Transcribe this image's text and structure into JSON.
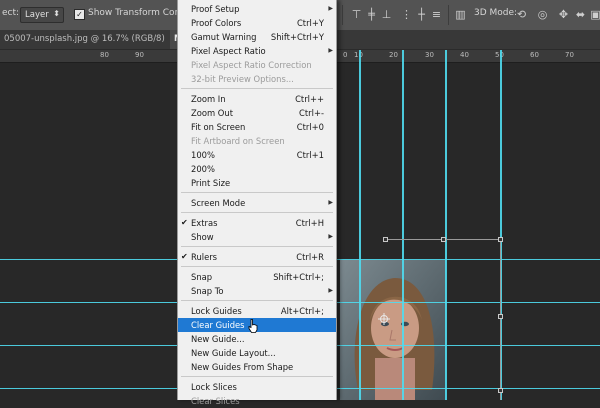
{
  "options_bar": {
    "prefix_label": "ect:",
    "select_value": "Layer",
    "checkbox_label": "Show Transform Controls",
    "mode_3d_label": "3D Mode:"
  },
  "tabs": [
    {
      "label": "05007-unsplash.jpg @ 16.7% (RGB/8)"
    },
    {
      "label": "My"
    }
  ],
  "ruler": {
    "labels": [
      "10",
      "20",
      "30",
      "40",
      "50",
      "60",
      "70",
      "80",
      "90",
      "0"
    ]
  },
  "colors": {
    "guide": "#4fdcf0",
    "highlight": "#1f79d3",
    "menu_bg": "#f0f0f0"
  },
  "view_menu": [
    {
      "type": "item",
      "label": "Proof Setup",
      "shortcut": "",
      "submenu": true
    },
    {
      "type": "item",
      "label": "Proof Colors",
      "shortcut": "Ctrl+Y"
    },
    {
      "type": "item",
      "label": "Gamut Warning",
      "shortcut": "Shift+Ctrl+Y"
    },
    {
      "type": "item",
      "label": "Pixel Aspect Ratio",
      "shortcut": "",
      "submenu": true
    },
    {
      "type": "item",
      "label": "Pixel Aspect Ratio Correction",
      "disabled": true
    },
    {
      "type": "item",
      "label": "32-bit Preview Options...",
      "disabled": true
    },
    {
      "type": "separator"
    },
    {
      "type": "item",
      "label": "Zoom In",
      "shortcut": "Ctrl++"
    },
    {
      "type": "item",
      "label": "Zoom Out",
      "shortcut": "Ctrl+-"
    },
    {
      "type": "item",
      "label": "Fit on Screen",
      "shortcut": "Ctrl+0"
    },
    {
      "type": "item",
      "label": "Fit Artboard on Screen",
      "disabled": true
    },
    {
      "type": "item",
      "label": "100%",
      "shortcut": "Ctrl+1"
    },
    {
      "type": "item",
      "label": "200%"
    },
    {
      "type": "item",
      "label": "Print Size"
    },
    {
      "type": "separator"
    },
    {
      "type": "item",
      "label": "Screen Mode",
      "submenu": true
    },
    {
      "type": "separator"
    },
    {
      "type": "item",
      "label": "Extras",
      "shortcut": "Ctrl+H",
      "checked": true
    },
    {
      "type": "item",
      "label": "Show",
      "submenu": true
    },
    {
      "type": "separator"
    },
    {
      "type": "item",
      "label": "Rulers",
      "shortcut": "Ctrl+R",
      "checked": true
    },
    {
      "type": "separator"
    },
    {
      "type": "item",
      "label": "Snap",
      "shortcut": "Shift+Ctrl+;"
    },
    {
      "type": "item",
      "label": "Snap To",
      "submenu": true
    },
    {
      "type": "separator"
    },
    {
      "type": "item",
      "label": "Lock Guides",
      "shortcut": "Alt+Ctrl+;"
    },
    {
      "type": "item",
      "label": "Clear Guides",
      "highlighted": true
    },
    {
      "type": "item",
      "label": "New Guide..."
    },
    {
      "type": "item",
      "label": "New Guide Layout..."
    },
    {
      "type": "item",
      "label": "New Guides From Shape"
    },
    {
      "type": "separator"
    },
    {
      "type": "item",
      "label": "Lock Slices"
    },
    {
      "type": "item",
      "label": "Clear Slices",
      "disabled": true
    }
  ]
}
